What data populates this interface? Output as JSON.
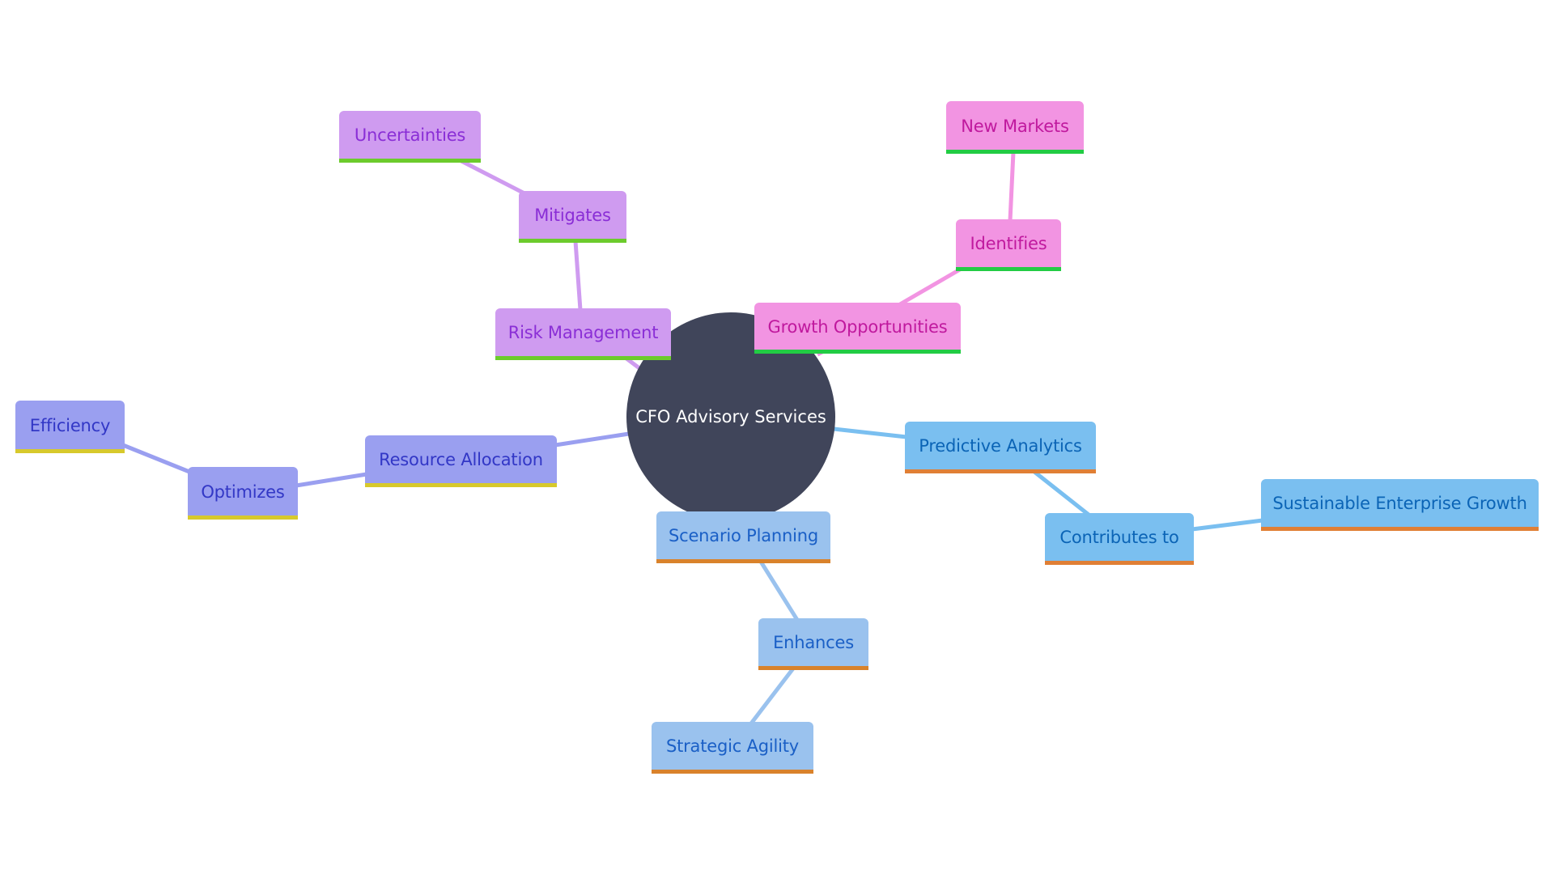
{
  "diagram": {
    "type": "mindmap",
    "root": {
      "id": "root",
      "label": "CFO Advisory Services",
      "color": "#40455a"
    },
    "nodes": [
      {
        "id": "risk",
        "label": "Risk Management",
        "theme": "lavender"
      },
      {
        "id": "mitigates",
        "label": "Mitigates",
        "theme": "lavender"
      },
      {
        "id": "uncertainties",
        "label": "Uncertainties",
        "theme": "lavender"
      },
      {
        "id": "growth",
        "label": "Growth Opportunities",
        "theme": "pink"
      },
      {
        "id": "identifies",
        "label": "Identifies",
        "theme": "pink"
      },
      {
        "id": "newmarkets",
        "label": "New Markets",
        "theme": "pink"
      },
      {
        "id": "resource",
        "label": "Resource Allocation",
        "theme": "indigo"
      },
      {
        "id": "optimizes",
        "label": "Optimizes",
        "theme": "indigo"
      },
      {
        "id": "efficiency",
        "label": "Efficiency",
        "theme": "indigo"
      },
      {
        "id": "predictive",
        "label": "Predictive Analytics",
        "theme": "blue"
      },
      {
        "id": "contributes",
        "label": "Contributes to",
        "theme": "blue"
      },
      {
        "id": "sustainable",
        "label": "Sustainable Enterprise Growth",
        "theme": "blue"
      },
      {
        "id": "scenario",
        "label": "Scenario Planning",
        "theme": "light-blue"
      },
      {
        "id": "enhances",
        "label": "Enhances",
        "theme": "light-blue"
      },
      {
        "id": "agility",
        "label": "Strategic Agility",
        "theme": "light-blue"
      }
    ],
    "edges": [
      {
        "from": "root",
        "to": "risk"
      },
      {
        "from": "risk",
        "to": "mitigates"
      },
      {
        "from": "mitigates",
        "to": "uncertainties"
      },
      {
        "from": "root",
        "to": "growth"
      },
      {
        "from": "growth",
        "to": "identifies"
      },
      {
        "from": "identifies",
        "to": "newmarkets"
      },
      {
        "from": "root",
        "to": "resource"
      },
      {
        "from": "resource",
        "to": "optimizes"
      },
      {
        "from": "optimizes",
        "to": "efficiency"
      },
      {
        "from": "root",
        "to": "predictive"
      },
      {
        "from": "predictive",
        "to": "contributes"
      },
      {
        "from": "contributes",
        "to": "sustainable"
      },
      {
        "from": "root",
        "to": "scenario"
      },
      {
        "from": "scenario",
        "to": "enhances"
      },
      {
        "from": "enhances",
        "to": "agility"
      }
    ],
    "themes": {
      "blue": {
        "fill": "#7abff0",
        "text": "#0b64b6",
        "accent": "#e07f35",
        "edge": "#7abff0"
      },
      "light-blue": {
        "fill": "#9ac2ee",
        "text": "#1a5fc6",
        "accent": "#d9822b",
        "edge": "#9ac2ee"
      },
      "indigo": {
        "fill": "#9a9ff0",
        "text": "#3237c6",
        "accent": "#d7c92c",
        "edge": "#9a9ff0"
      },
      "lavender": {
        "fill": "#cf9bf0",
        "text": "#8a2ed6",
        "accent": "#6ccb2c",
        "edge": "#cf9bf0"
      },
      "pink": {
        "fill": "#f294e2",
        "text": "#c0199e",
        "accent": "#22cc44",
        "edge": "#f294e2"
      }
    }
  }
}
